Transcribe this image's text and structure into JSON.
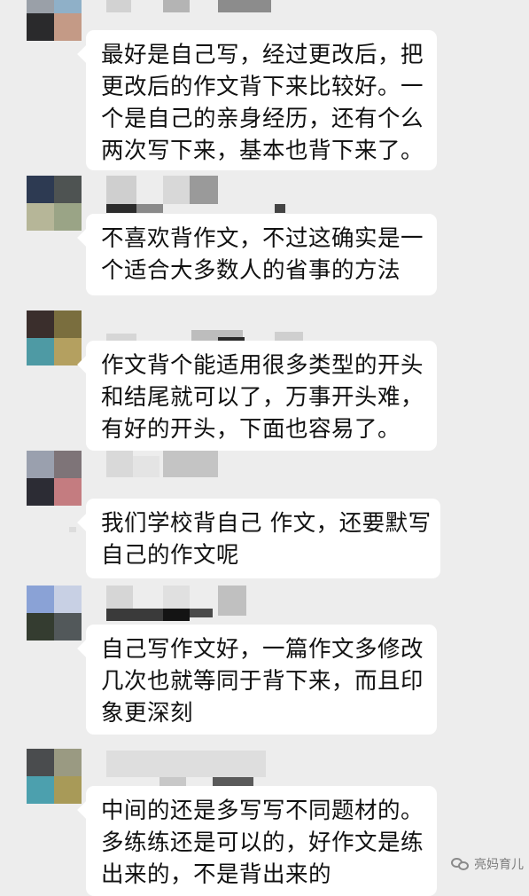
{
  "messages": [
    {
      "lines": [
        "最好是自己写，经过更改后，把",
        "更改后的作文背下来比较好。一",
        "个是自己的亲身经历，还有个么",
        "两次写下来，基本也背下来了。"
      ]
    },
    {
      "lines": [
        "不喜欢背作文，不过这确实是一",
        "个适合大多数人的省事的方法"
      ]
    },
    {
      "lines": [
        "作文背个能适用很多类型的开头",
        "和结尾就可以了，万事开头难，",
        "有好的开头，下面也容易了。"
      ]
    },
    {
      "lines": [
        "我们学校背自己 作文，还要默写",
        "自己的作文呢"
      ]
    },
    {
      "lines": [
        "自己写作文好，一篇作文多修改",
        "几次也就等同于背下来，而且印",
        "象更深刻"
      ]
    },
    {
      "lines": [
        "中间的还是多写写不同题材的。",
        "多练练还是可以的，好作文是练",
        "出来的，不是背出来的"
      ]
    }
  ],
  "watermark": {
    "text": "亮妈育儿"
  },
  "colors": {
    "background": "#ededed",
    "bubble": "#ffffff",
    "text": "#111111"
  }
}
